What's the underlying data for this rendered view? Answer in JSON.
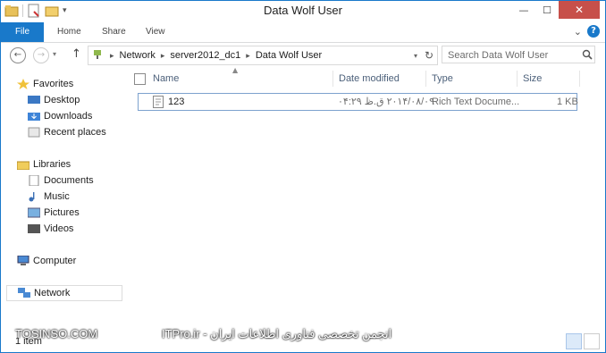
{
  "window": {
    "title": "Data Wolf User",
    "minimize": "—",
    "maximize": "☐",
    "close": "✕"
  },
  "ribbon": {
    "tabs": [
      "File",
      "Home",
      "Share",
      "View"
    ],
    "expand": "⌄",
    "help": "?"
  },
  "address": {
    "back": "←",
    "forward": "→",
    "up": "↑",
    "segments": [
      "Network",
      "server2012_dc1",
      "Data Wolf User"
    ],
    "refresh": "↻",
    "search_placeholder": "Search Data Wolf User"
  },
  "nav": {
    "favorites": "Favorites",
    "desktop": "Desktop",
    "downloads": "Downloads",
    "recent": "Recent places",
    "libraries": "Libraries",
    "documents": "Documents",
    "music": "Music",
    "pictures": "Pictures",
    "videos": "Videos",
    "computer": "Computer",
    "network": "Network"
  },
  "columns": {
    "name": "Name",
    "date": "Date modified",
    "type": "Type",
    "size": "Size"
  },
  "files": [
    {
      "name": "123",
      "date": "۲۰۱۴/۰۸/۰۹ ق.ظ ۰۴:۲۹",
      "type": "Rich Text Docume...",
      "size": "1 KB"
    }
  ],
  "status": {
    "count": "1 item"
  },
  "watermark": {
    "left": "TOSINSO.COM",
    "right": "ITPro.ir - انجمن تخصصی فناوری اطلاعات ایران"
  }
}
